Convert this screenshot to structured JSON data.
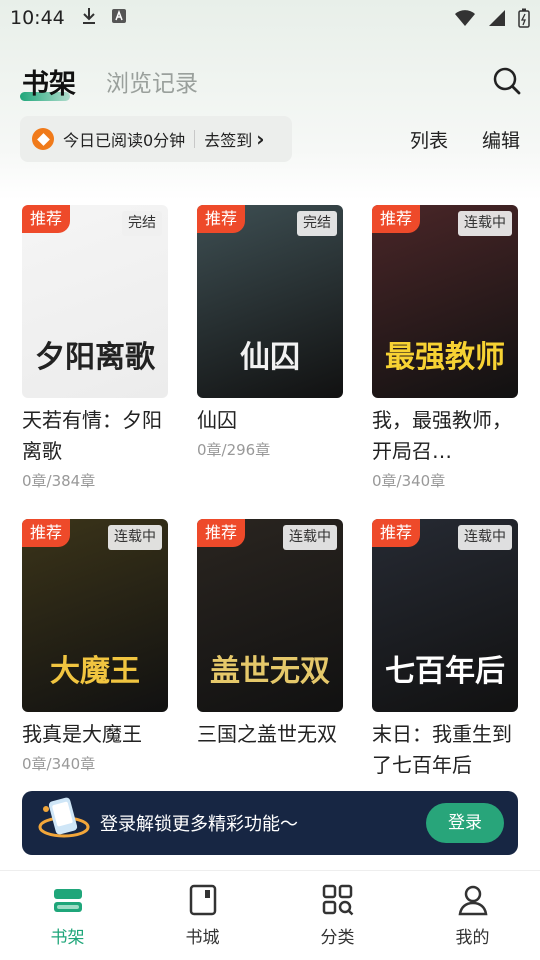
{
  "status_bar": {
    "time": "10:44"
  },
  "header": {
    "tab_active": "书架",
    "tab_inactive": "浏览记录"
  },
  "reading": {
    "text": "今日已阅读0分钟",
    "checkin": "去签到",
    "checkin_arrow": "›"
  },
  "actions": {
    "list": "列表",
    "edit": "编辑"
  },
  "books": [
    {
      "title": "天若有情：夕阳离歌",
      "progress": "0章/384章",
      "badge": "推荐",
      "status": "完结",
      "cover_text": "夕阳离歌",
      "cover_bg": "#ececec",
      "cover_fg": "#222"
    },
    {
      "title": "仙囚",
      "progress": "0章/296章",
      "badge": "推荐",
      "status": "完结",
      "cover_text": "仙囚",
      "cover_bg": "#3e4f53",
      "cover_fg": "#f2f2f2"
    },
    {
      "title": "我，最强教师，开局召…",
      "progress": "0章/340章",
      "badge": "推荐",
      "status": "连载中",
      "cover_text": "最强教师",
      "cover_bg": "#4a2628",
      "cover_fg": "#f7d233"
    },
    {
      "title": "我真是大魔王",
      "progress": "0章/340章",
      "badge": "推荐",
      "status": "连载中",
      "cover_text": "大魔王",
      "cover_bg": "#3b3419",
      "cover_fg": "#f1c540"
    },
    {
      "title": "三国之盖世无双",
      "progress": "",
      "badge": "推荐",
      "status": "连载中",
      "cover_text": "盖世无双",
      "cover_bg": "#2a2520",
      "cover_fg": "#e5c86a"
    },
    {
      "title": "末日：我重生到了七百年后",
      "progress": "",
      "badge": "推荐",
      "status": "连载中",
      "cover_text": "七百年后",
      "cover_bg": "#262a33",
      "cover_fg": "#ffffff"
    }
  ],
  "banner": {
    "text": "登录解锁更多精彩功能～",
    "button": "登录"
  },
  "nav": [
    {
      "label": "书架",
      "active": true
    },
    {
      "label": "书城",
      "active": false
    },
    {
      "label": "分类",
      "active": false
    },
    {
      "label": "我的",
      "active": false
    }
  ],
  "colors": {
    "accent": "#1fa67a",
    "badge": "#ee4a2a",
    "banner": "#172643"
  }
}
